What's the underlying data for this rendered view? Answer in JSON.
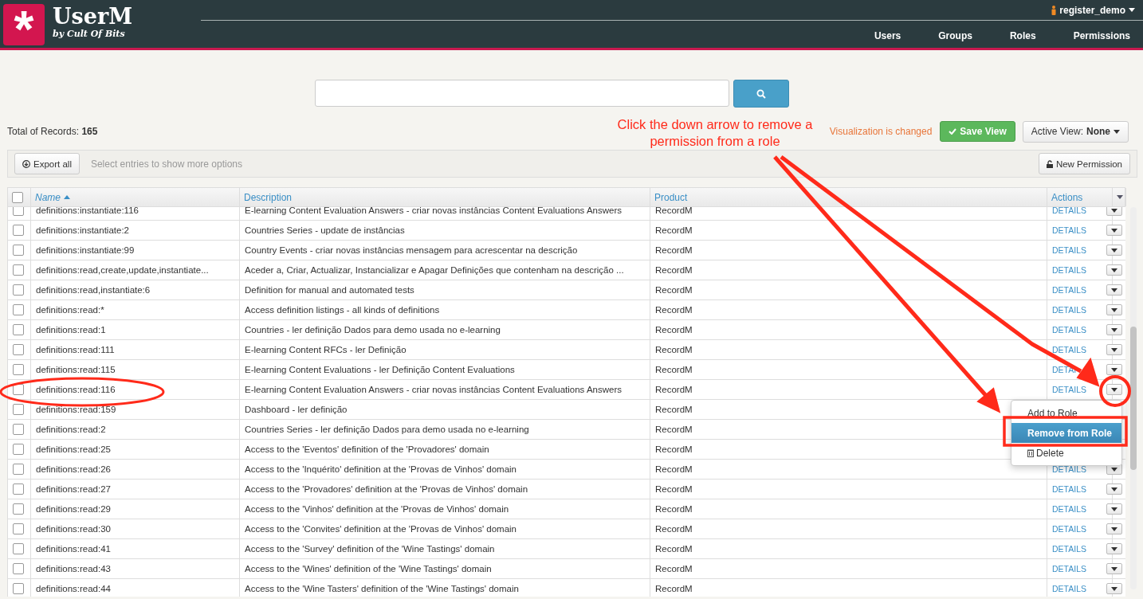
{
  "header": {
    "logo_mark": "*",
    "app_name": "UserM",
    "tagline": "by Cult Of Bits",
    "user": "register_demo",
    "nav": [
      {
        "label": "Users"
      },
      {
        "label": "Groups"
      },
      {
        "label": "Roles"
      },
      {
        "label": "Permissions"
      }
    ]
  },
  "summary": {
    "label": "Total of Records:",
    "count": "165"
  },
  "view": {
    "status": "Visualization is changed",
    "save_label": "Save View",
    "active_label": "Active View:",
    "active_value": "None"
  },
  "toolbar": {
    "export_label": "Export all",
    "hint": "Select entries to show more options",
    "new_label": "New Permission"
  },
  "table": {
    "select_all_checked": false,
    "columns": [
      {
        "label": "Name",
        "sort_ascending": true
      },
      {
        "label": "Description"
      },
      {
        "label": "Product"
      },
      {
        "label": "Actions"
      }
    ],
    "rows": [
      {
        "name": "definitions:instantiate:116",
        "description": "E-learning Content Evaluation Answers - criar novas instâncias Content Evaluations Answers",
        "product": "RecordM",
        "details": "DETAILS",
        "checked": false
      },
      {
        "name": "definitions:instantiate:2",
        "description": "Countries Series - update de instâncias",
        "product": "RecordM",
        "details": "DETAILS",
        "checked": false
      },
      {
        "name": "definitions:instantiate:99",
        "description": "Country Events - criar novas instâncias mensagem para acrescentar na descrição",
        "product": "RecordM",
        "details": "DETAILS",
        "checked": false
      },
      {
        "name": "definitions:read,create,update,instantiate...",
        "description": "Aceder a, Criar, Actualizar, Instancializar e Apagar Definições que contenham na descrição ...",
        "product": "RecordM",
        "details": "DETAILS",
        "checked": false
      },
      {
        "name": "definitions:read,instantiate:6",
        "description": "Definition for manual and automated tests",
        "product": "RecordM",
        "details": "DETAILS",
        "checked": false
      },
      {
        "name": "definitions:read:*",
        "description": "Access definition listings - all kinds of definitions",
        "product": "RecordM",
        "details": "DETAILS",
        "checked": false
      },
      {
        "name": "definitions:read:1",
        "description": "Countries - ler definição Dados para demo usada no e-learning",
        "product": "RecordM",
        "details": "DETAILS",
        "checked": false
      },
      {
        "name": "definitions:read:111",
        "description": "E-learning Content RFCs - ler Definição",
        "product": "RecordM",
        "details": "DETAILS",
        "checked": false
      },
      {
        "name": "definitions:read:115",
        "description": "E-learning Content Evaluations - ler Definição Content Evaluations",
        "product": "RecordM",
        "details": "DETAI",
        "checked": false
      },
      {
        "name": "definitions:read:116",
        "description": "E-learning Content Evaluation Answers - criar novas instâncias Content Evaluations Answers",
        "product": "RecordM",
        "details": "DETAILS",
        "checked": false
      },
      {
        "name": "definitions:read:159",
        "description": "Dashboard - ler definição",
        "product": "RecordM",
        "checked": false
      },
      {
        "name": "definitions:read:2",
        "description": "Countries Series - ler definição Dados para demo usada no e-learning",
        "product": "RecordM",
        "checked": false
      },
      {
        "name": "definitions:read:25",
        "description": "Access to the 'Eventos' definition of the 'Provadores' domain",
        "product": "RecordM",
        "checked": false
      },
      {
        "name": "definitions:read:26",
        "description": "Access to the 'Inquérito' definition at the 'Provas de Vinhos' domain",
        "product": "RecordM",
        "details": "DETAILS",
        "checked": false
      },
      {
        "name": "definitions:read:27",
        "description": "Access to the 'Provadores' definition at the 'Provas de Vinhos' domain",
        "product": "RecordM",
        "details": "DETAILS",
        "checked": false
      },
      {
        "name": "definitions:read:29",
        "description": "Access to the 'Vinhos' definition at the 'Provas de Vinhos' domain",
        "product": "RecordM",
        "details": "DETAILS",
        "checked": false
      },
      {
        "name": "definitions:read:30",
        "description": "Access to the 'Convites' definition at the 'Provas de Vinhos' domain",
        "product": "RecordM",
        "details": "DETAILS",
        "checked": false
      },
      {
        "name": "definitions:read:41",
        "description": "Access to the 'Survey' definition of the 'Wine Tastings' domain",
        "product": "RecordM",
        "details": "DETAILS",
        "checked": false
      },
      {
        "name": "definitions:read:43",
        "description": "Access to the 'Wines' definition of the 'Wine Tastings' domain",
        "product": "RecordM",
        "details": "DETAILS",
        "checked": false
      },
      {
        "name": "definitions:read:44",
        "description": "Access to the 'Wine Tasters' definition of the 'Wine Tastings' domain",
        "product": "RecordM",
        "details": "DETAILS",
        "checked": false
      }
    ]
  },
  "row_menu": {
    "items": [
      {
        "label": "Add to Role",
        "kind": "plain",
        "selected": false
      },
      {
        "label": "Remove from Role",
        "kind": "plain",
        "selected": true
      },
      {
        "label": "Delete",
        "kind": "trash",
        "selected": false
      }
    ]
  },
  "annotation": {
    "text": "Click the down arrow to remove a permission from a role"
  }
}
